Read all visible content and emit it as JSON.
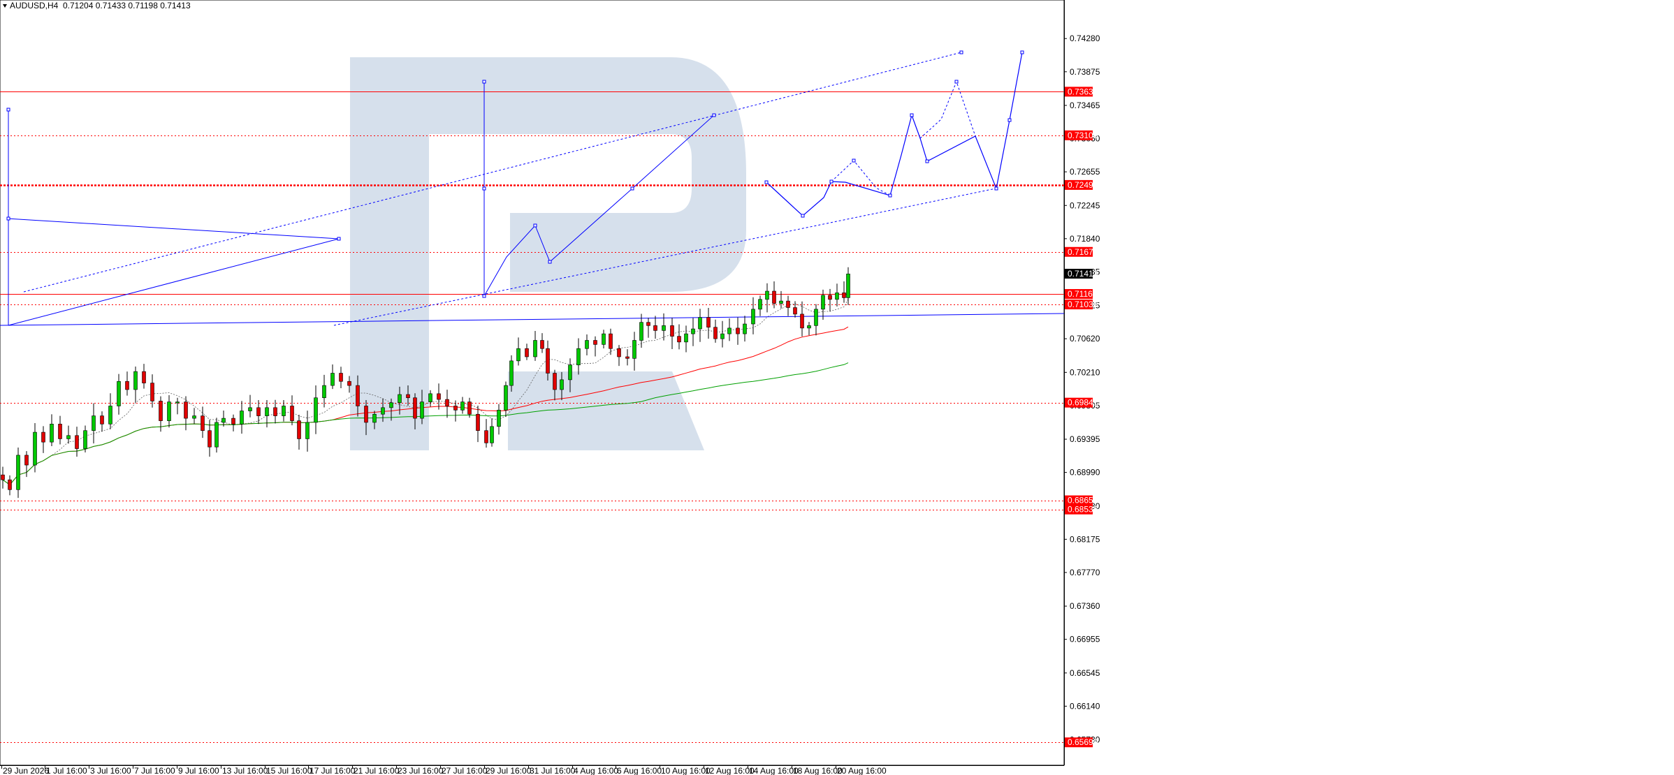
{
  "header": {
    "symbol": "AUDUSD,H4",
    "ohlc": "0.71204 0.71433 0.71198 0.71413",
    "menu_icon": "triangle-down-icon"
  },
  "colors": {
    "bull": "#00c800",
    "bear": "#e00000",
    "level": "#ff0000",
    "forecast": "#0000ff",
    "ma_fast": "#ff0000",
    "ma_slow": "#00a000",
    "watermark": "#d6e0ec",
    "axis_badge_bg": "#ff0000",
    "current_badge_bg": "#000000"
  },
  "chart_data": {
    "type": "candlestick",
    "title": "AUDUSD,H4",
    "ylim": [
      0.6542,
      0.7475
    ],
    "y_ticks": [
      "0.74280",
      "0.73875",
      "0.73465",
      "0.73060",
      "0.72655",
      "0.72245",
      "0.71840",
      "0.71435",
      "0.71025",
      "0.70620",
      "0.70210",
      "0.69805",
      "0.69395",
      "0.68990",
      "0.68580",
      "0.68175",
      "0.67770",
      "0.67360",
      "0.66955",
      "0.66545",
      "0.66140",
      "0.65730"
    ],
    "x_ticks": [
      "29 Jun 2026",
      "1 Jul 16:00",
      "3 Jul 16:00",
      "7 Jul 16:00",
      "9 Jul 16:00",
      "13 Jul 16:00",
      "15 Jul 16:00",
      "17 Jul 16:00",
      "21 Jul 16:00",
      "23 Jul 16:00",
      "27 Jul 16:00",
      "29 Jul 16:00",
      "31 Jul 16:00",
      "4 Aug 16:00",
      "6 Aug 16:00",
      "10 Aug 16:00",
      "12 Aug 16:00",
      "14 Aug 16:00",
      "18 Aug 16:00",
      "20 Aug 16:00"
    ],
    "levels": [
      {
        "price": "0.73632",
        "style": "solid"
      },
      {
        "price": "0.73100",
        "style": "dotted"
      },
      {
        "price": "0.72495",
        "style": "thick-dotted"
      },
      {
        "price": "0.71679",
        "style": "dotted"
      },
      {
        "price": "0.71166",
        "style": "solid"
      },
      {
        "price": "0.71038",
        "style": "dotted"
      },
      {
        "price": "0.69841",
        "style": "dotted"
      },
      {
        "price": "0.68650",
        "style": "dotted"
      },
      {
        "price": "0.68538",
        "style": "dotted"
      },
      {
        "price": "0.65699",
        "style": "dotted"
      }
    ],
    "current_price": "0.71413",
    "close_path": [
      [
        0,
        0.689
      ],
      [
        10,
        0.6878
      ],
      [
        22,
        0.692
      ],
      [
        34,
        0.6908
      ],
      [
        46,
        0.6948
      ],
      [
        58,
        0.6936
      ],
      [
        70,
        0.6958
      ],
      [
        82,
        0.694
      ],
      [
        94,
        0.6944
      ],
      [
        106,
        0.6928
      ],
      [
        118,
        0.695
      ],
      [
        130,
        0.6968
      ],
      [
        142,
        0.6958
      ],
      [
        154,
        0.698
      ],
      [
        166,
        0.701
      ],
      [
        178,
        0.7
      ],
      [
        190,
        0.7022
      ],
      [
        202,
        0.7008
      ],
      [
        214,
        0.6986
      ],
      [
        226,
        0.6962
      ],
      [
        238,
        0.6985
      ],
      [
        250,
        0.6985
      ],
      [
        262,
        0.6965
      ],
      [
        274,
        0.6968
      ],
      [
        286,
        0.695
      ],
      [
        296,
        0.693
      ],
      [
        306,
        0.696
      ],
      [
        316,
        0.6965
      ],
      [
        330,
        0.6958
      ],
      [
        342,
        0.6974
      ],
      [
        354,
        0.6978
      ],
      [
        366,
        0.6968
      ],
      [
        378,
        0.6978
      ],
      [
        390,
        0.6968
      ],
      [
        402,
        0.698
      ],
      [
        414,
        0.6962
      ],
      [
        424,
        0.694
      ],
      [
        436,
        0.696
      ],
      [
        448,
        0.699
      ],
      [
        460,
        0.7005
      ],
      [
        472,
        0.702
      ],
      [
        484,
        0.701
      ],
      [
        496,
        0.7005
      ],
      [
        508,
        0.698
      ],
      [
        520,
        0.696
      ],
      [
        532,
        0.697
      ],
      [
        544,
        0.6978
      ],
      [
        556,
        0.6984
      ],
      [
        568,
        0.6994
      ],
      [
        580,
        0.699
      ],
      [
        590,
        0.6965
      ],
      [
        600,
        0.6985
      ],
      [
        612,
        0.6995
      ],
      [
        624,
        0.6988
      ],
      [
        636,
        0.698
      ],
      [
        648,
        0.6975
      ],
      [
        658,
        0.6985
      ],
      [
        668,
        0.697
      ],
      [
        680,
        0.695
      ],
      [
        692,
        0.6935
      ],
      [
        700,
        0.6955
      ],
      [
        710,
        0.6975
      ],
      [
        720,
        0.7005
      ],
      [
        728,
        0.7035
      ],
      [
        738,
        0.705
      ],
      [
        750,
        0.704
      ],
      [
        762,
        0.706
      ],
      [
        772,
        0.705
      ],
      [
        780,
        0.702
      ],
      [
        790,
        0.7
      ],
      [
        800,
        0.7012
      ],
      [
        812,
        0.703
      ],
      [
        824,
        0.705
      ],
      [
        836,
        0.706
      ],
      [
        848,
        0.7055
      ],
      [
        860,
        0.7068
      ],
      [
        870,
        0.705
      ],
      [
        882,
        0.704
      ],
      [
        894,
        0.7038
      ],
      [
        904,
        0.706
      ],
      [
        914,
        0.7082
      ],
      [
        924,
        0.7078
      ],
      [
        934,
        0.7072
      ],
      [
        946,
        0.7078
      ],
      [
        958,
        0.7065
      ],
      [
        968,
        0.7058
      ],
      [
        978,
        0.7068
      ],
      [
        988,
        0.7074
      ],
      [
        998,
        0.7088
      ],
      [
        1010,
        0.7076
      ],
      [
        1020,
        0.7062
      ],
      [
        1030,
        0.7068
      ],
      [
        1040,
        0.7075
      ],
      [
        1052,
        0.7068
      ],
      [
        1062,
        0.708
      ],
      [
        1074,
        0.7098
      ],
      [
        1084,
        0.711
      ],
      [
        1094,
        0.712
      ],
      [
        1104,
        0.7105
      ],
      [
        1114,
        0.7108
      ],
      [
        1124,
        0.71
      ],
      [
        1134,
        0.7092
      ],
      [
        1144,
        0.7075
      ],
      [
        1154,
        0.7078
      ],
      [
        1164,
        0.7098
      ],
      [
        1174,
        0.7115
      ],
      [
        1184,
        0.711
      ],
      [
        1194,
        0.7118
      ],
      [
        1204,
        0.7112
      ],
      [
        1210,
        0.7141
      ]
    ]
  }
}
